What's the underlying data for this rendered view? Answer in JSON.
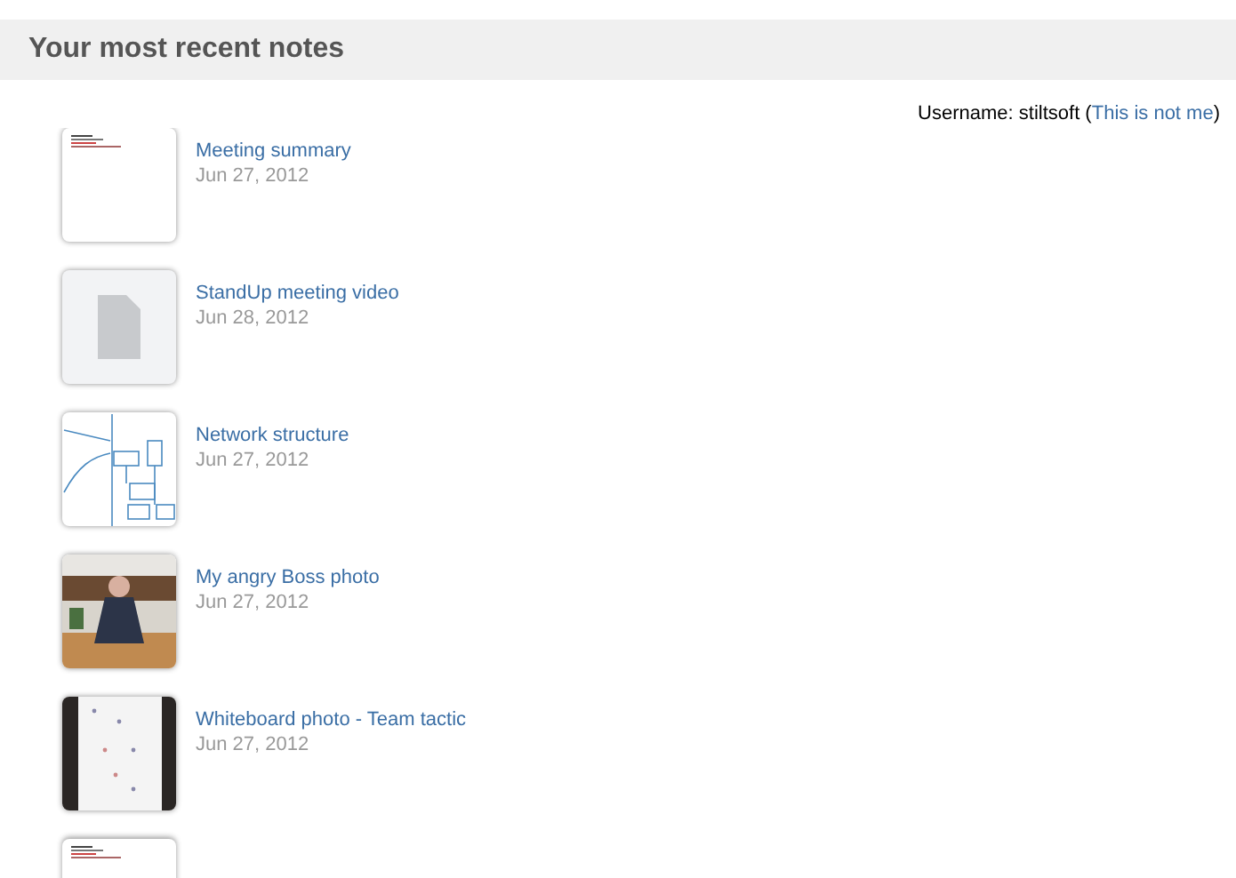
{
  "header": {
    "title": "Your most recent notes"
  },
  "user": {
    "label": "Username: stiltsoft (",
    "link": "This is not me",
    "suffix": ")"
  },
  "notes": [
    {
      "kind": "document",
      "title": "Meeting summary",
      "date": "Jun 27, 2012"
    },
    {
      "kind": "file",
      "title": "StandUp meeting video",
      "date": "Jun 28, 2012"
    },
    {
      "kind": "sketch",
      "title": "Network structure",
      "date": "Jun 27, 2012"
    },
    {
      "title": "My angry Boss photo",
      "date": "Jun 27, 2012"
    },
    {
      "kind": "whiteboard",
      "title": "Whiteboard photo - Team tactic",
      "date": "Jun 27, 2012"
    },
    {
      "kind": "document"
    }
  ]
}
